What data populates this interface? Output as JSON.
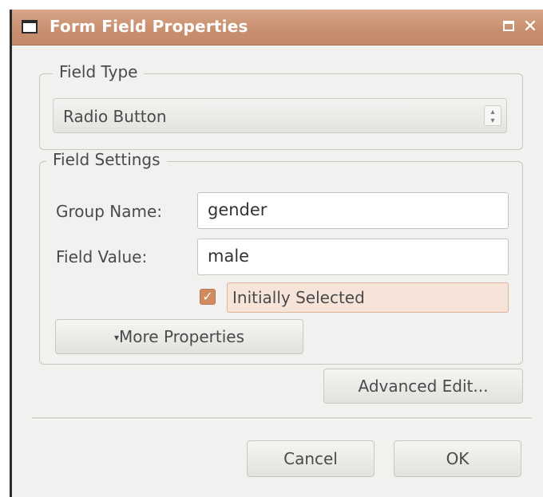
{
  "window": {
    "title": "Form Field Properties"
  },
  "field_type": {
    "legend": "Field Type",
    "selected": "Radio Button"
  },
  "field_settings": {
    "legend": "Field Settings",
    "group_name_label": "Group Name:",
    "group_name_value": "gender",
    "field_value_label": "Field Value:",
    "field_value_value": "male",
    "initially_selected_label": "Initially Selected",
    "initially_selected_checked": true,
    "more_properties_label": "More Properties"
  },
  "actions": {
    "advanced_edit_label": "Advanced Edit...",
    "cancel_label": "Cancel",
    "ok_label": "OK"
  },
  "colors": {
    "titlebar": "#c89070",
    "checkbox": "#d08a5f",
    "highlight": "#f7e4d9"
  }
}
